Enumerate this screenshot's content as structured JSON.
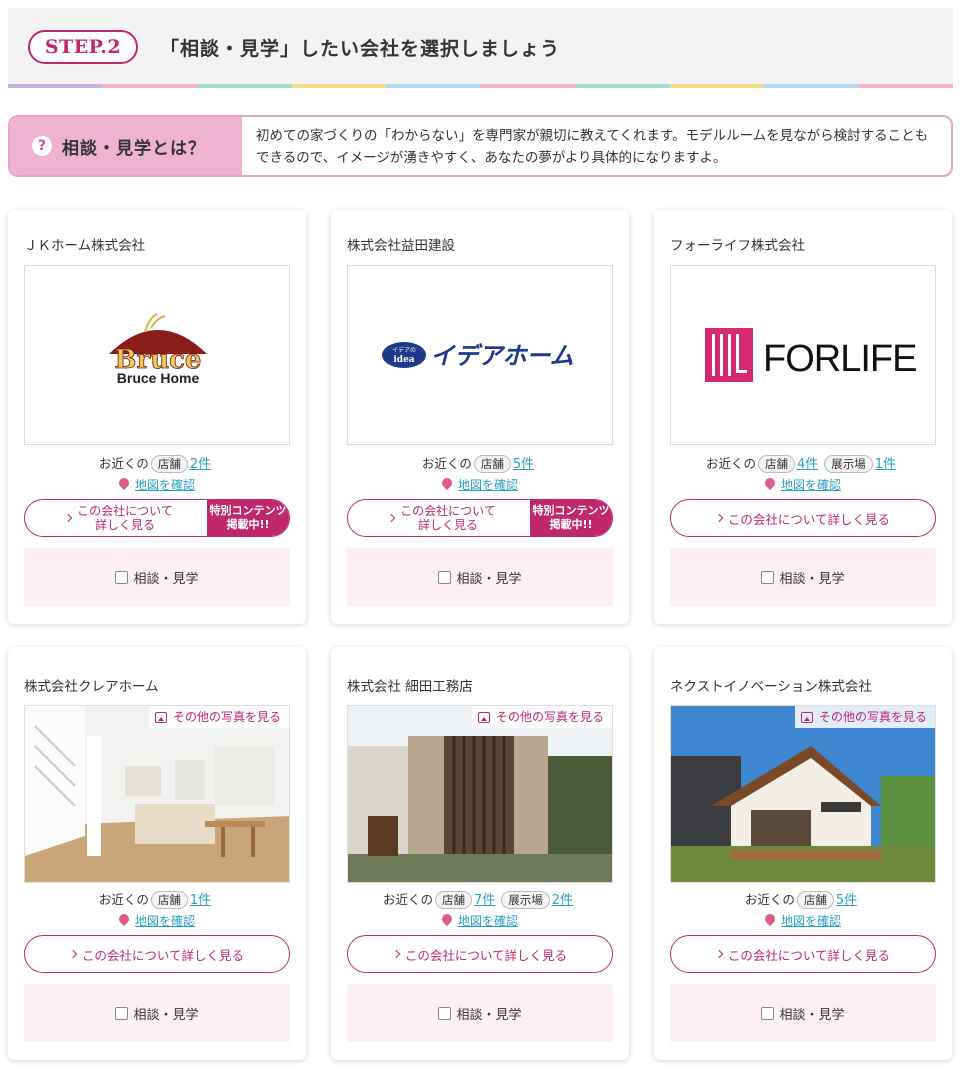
{
  "step": {
    "badge": "STEP.2",
    "title": "「相談・見学」したい会社を選択しましょう"
  },
  "rainbow_colors": [
    "#c9b3d8",
    "#f3b6c9",
    "#a8dcd0",
    "#f3e08a",
    "#b8d8ef",
    "#f3b6c9",
    "#a8dcd0",
    "#f3e08a",
    "#b8d8ef",
    "#f3b6c9"
  ],
  "info": {
    "heading": "相談・見学とは？",
    "icon": "question-icon",
    "text": "初めての家づくりの「わからない」を専門家が親切に教えてくれます。モデルルームを見ながら検討することもできるので、イメージが湧きやすく、あなたの夢がより具体的になりますよ。"
  },
  "labels": {
    "near_prefix": "お近くの",
    "store_pill": "店舗",
    "showroom_pill": "展示場",
    "map_link": "地図を確認",
    "detail_full": "この会社について詳しく見る",
    "detail_short_1": "この会社について",
    "detail_short_2": "詳しく見る",
    "special_1": "特別コンテンツ",
    "special_2": "掲載中!!",
    "consult": "相談・見学",
    "more_photos": "その他の写真を見る"
  },
  "companies": [
    {
      "name": "ＪＫホーム株式会社",
      "logo_text_1": "Bruce",
      "logo_text_2": "Bruce Home",
      "stores": "2件",
      "showrooms": "",
      "special": true
    },
    {
      "name": "株式会社益田建設",
      "logo_badge_1": "イデアの",
      "logo_badge_2": "idea",
      "logo_text": "イデアホーム",
      "stores": "5件",
      "showrooms": "",
      "special": true
    },
    {
      "name": "フォーライフ株式会社",
      "logo_text": "FORLIFE",
      "stores": "4件",
      "showrooms": "1件",
      "special": false
    },
    {
      "name": "株式会社クレアホーム",
      "stores": "1件",
      "showrooms": "",
      "special": false
    },
    {
      "name": "株式会社 細田工務店",
      "stores": "7件",
      "showrooms": "2件",
      "special": false
    },
    {
      "name": "ネクストイノベーション株式会社",
      "stores": "5件",
      "showrooms": "",
      "special": false
    }
  ]
}
